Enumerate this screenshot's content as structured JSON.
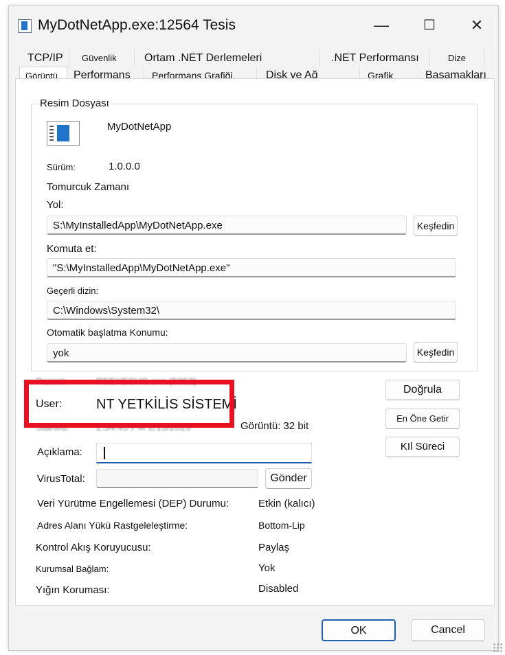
{
  "window": {
    "title": "MyDotNetApp.exe:12564 Tesis"
  },
  "tabs_row1": [
    "TCP/IP",
    "Güvenlik",
    "Ortam .NET Derlemeleri",
    ".NET Performansı",
    "Dize"
  ],
  "tabs_row2": [
    "Görüntü",
    "Performans",
    "Performans Grafiği",
    "Disk ve Ağ",
    "Grafik",
    "Basamakları"
  ],
  "image_group": {
    "title": "Resim Dosyası",
    "app_name": "MyDotNetApp",
    "version_label": "Sürüm:",
    "version_value": "1.0.0.0",
    "bud_time_label": "Tomurcuk Zamanı",
    "path_label": "Yol:",
    "path_value": "S:\\MyInstalledApp\\MyDotNetApp.exe",
    "explore_label": "Keşfedin",
    "command_label": "Komuta et:",
    "command_value": "\"S:\\MyInstalledApp\\MyDotNetApp.exe\"",
    "cwd_label": "Geçerli dizin:",
    "cwd_value": "C:\\Windows\\System32\\",
    "autostart_label": "Otomatik başlatma Konumu:",
    "autostart_value": "yok",
    "explore2_label": "Keşfedin"
  },
  "process_info": {
    "parent_label": "Parent:",
    "parent_value": "PSEXESVC.exe (5952)",
    "user_label": "User:",
    "user_value": "NT YETKİLİS SİSTEMİ",
    "started_label": "Started:",
    "started_value": "2:34:45 PM   2/15/2025",
    "image_bits": "Görüntü: 32 bit",
    "verify_label": "Doğrula",
    "bring_front_label": "En Öne Getir",
    "kill_label": "KIl Süreci",
    "description_label": "Açıklama:",
    "description_value": "",
    "virustotal_label": "VirusTotal:",
    "submit_label": "Gönder"
  },
  "security": [
    {
      "label": "Veri Yürütme Engellemesi (DEP) Durumu:",
      "value": "Etkin (kalıcı)"
    },
    {
      "label": "Adres Alanı Yükü Rastgeleleştirme:",
      "value": "Bottom-Lip"
    },
    {
      "label": "Kontrol Akış Koruyucusu:",
      "value": "Paylaş"
    },
    {
      "label": "Kurumsal Bağlam:",
      "value": "Yok"
    },
    {
      "label": "Yığın Koruması:",
      "value": "Disabled"
    }
  ],
  "footer": {
    "ok_label": "OK",
    "cancel_label": "Cancel"
  }
}
